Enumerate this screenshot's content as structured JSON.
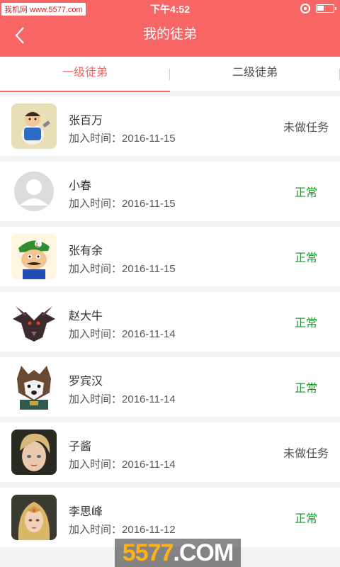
{
  "status_bar": {
    "watermark": "我机网 www.5577.com",
    "time": "下午4:52"
  },
  "header": {
    "title": "我的徒弟",
    "bg_color": "#f76565"
  },
  "tabs": [
    {
      "label": "一级徒弟",
      "active": true
    },
    {
      "label": "二级徒弟",
      "active": false
    }
  ],
  "students": [
    {
      "name": "张百万",
      "join_label": "加入时间：",
      "join_date": "2016-11-15",
      "status": "未做任务",
      "avatar": "cartoon-chef-avatar"
    },
    {
      "name": "小春",
      "join_label": "加入时间：",
      "join_date": "2016-11-15",
      "status": "正常",
      "avatar": "default-avatar"
    },
    {
      "name": "张有余",
      "join_label": "加入时间：",
      "join_date": "2016-11-15",
      "status": "正常",
      "avatar": "cartoon-plumber-avatar"
    },
    {
      "name": "赵大牛",
      "join_label": "加入时间：",
      "join_date": "2016-11-14",
      "status": "正常",
      "avatar": "dragon-avatar"
    },
    {
      "name": "罗宾汉",
      "join_label": "加入时间：",
      "join_date": "2016-11-14",
      "status": "正常",
      "avatar": "wolf-warrior-avatar"
    },
    {
      "name": "子酱",
      "join_label": "加入时间：",
      "join_date": "2016-11-14",
      "status": "未做任务",
      "avatar": "blond-boy-avatar"
    },
    {
      "name": "李思峰",
      "join_label": "加入时间：",
      "join_date": "2016-11-12",
      "status": "正常",
      "avatar": "elf-girl-avatar"
    }
  ],
  "status_colors": {
    "normal": "#1b9a2a",
    "pending": "#555555"
  },
  "footer_logo": {
    "prefix": "5577",
    "suffix": ".COM"
  }
}
